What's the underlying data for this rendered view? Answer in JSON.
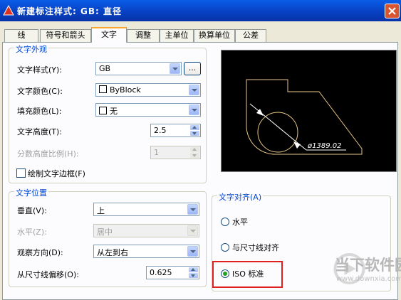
{
  "window": {
    "title": "新建标注样式: GB: 直径"
  },
  "tabs": [
    "线",
    "符号和箭头",
    "文字",
    "调整",
    "主单位",
    "换算单位",
    "公差"
  ],
  "active_tab": "文字",
  "appearance": {
    "title": "文字外观",
    "text_style": {
      "label": "文字样式(Y):",
      "value": "GB",
      "browse_label": "..."
    },
    "text_color": {
      "label": "文字颜色(C):",
      "value": "ByBlock"
    },
    "fill_color": {
      "label": "填充颜色(L):",
      "value": "无"
    },
    "text_height": {
      "label": "文字高度(T):",
      "value": "2.5"
    },
    "fraction_scale": {
      "label": "分数高度比例(H):",
      "value": "1"
    },
    "draw_frame": {
      "label": "绘制文字边框(F)",
      "checked": false
    }
  },
  "placement": {
    "title": "文字位置",
    "vertical": {
      "label": "垂直(V):",
      "value": "上"
    },
    "horizontal": {
      "label": "水平(Z):",
      "value": "居中"
    },
    "view_direction": {
      "label": "观察方向(D):",
      "value": "从左到右"
    },
    "offset": {
      "label": "从尺寸线偏移(O):",
      "value": "0.625"
    }
  },
  "preview": {
    "dimension_text": "ø1389.02",
    "line_color": "#e8c887",
    "dim_color": "#ffffff"
  },
  "alignment": {
    "title": "文字对齐(A)",
    "options": [
      "水平",
      "与尺寸线对齐",
      "ISO 标准"
    ],
    "selected": "ISO 标准"
  },
  "watermark": {
    "text": "当下软件园",
    "url": "www.downxia.com"
  }
}
